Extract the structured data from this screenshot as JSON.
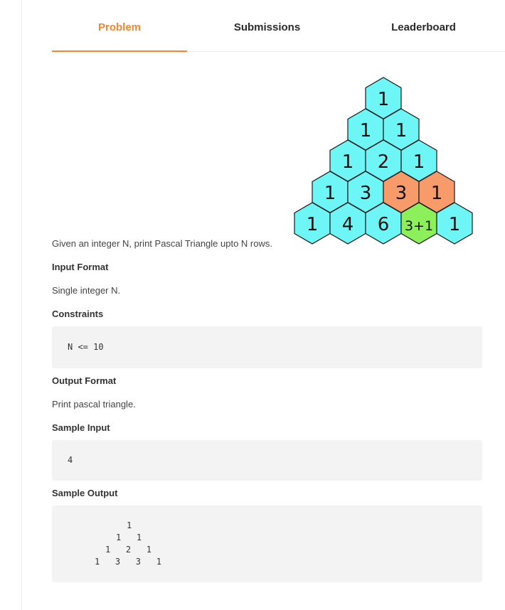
{
  "tabs": [
    {
      "label": "Problem",
      "active": true
    },
    {
      "label": "Submissions",
      "active": false
    },
    {
      "label": "Leaderboard",
      "active": false
    }
  ],
  "accent_color": "#f2882f",
  "figure": {
    "rows": [
      [
        "1"
      ],
      [
        "1",
        "1"
      ],
      [
        "1",
        "2",
        "1"
      ],
      [
        "1",
        "3",
        "3",
        "1"
      ],
      [
        "1",
        "4",
        "6",
        "3+1",
        "1"
      ]
    ],
    "highlight_orange": "#f79b6b",
    "highlight_green": "#8cf05a",
    "cell_color": "#6ef5f5"
  },
  "problem": {
    "description": "Given an integer N, print Pascal Triangle upto N rows.",
    "input_format_heading": "Input Format",
    "input_format_text": "Single integer N.",
    "constraints_heading": "Constraints",
    "constraints_code": "N <= 10",
    "output_format_heading": "Output Format",
    "output_format_text": "Print pascal triangle.",
    "sample_input_heading": "Sample Input",
    "sample_input_code": "4",
    "sample_output_heading": "Sample Output",
    "sample_output_lines": [
      "1",
      "1   1",
      "1   2   1",
      "1   3   3   1"
    ]
  }
}
